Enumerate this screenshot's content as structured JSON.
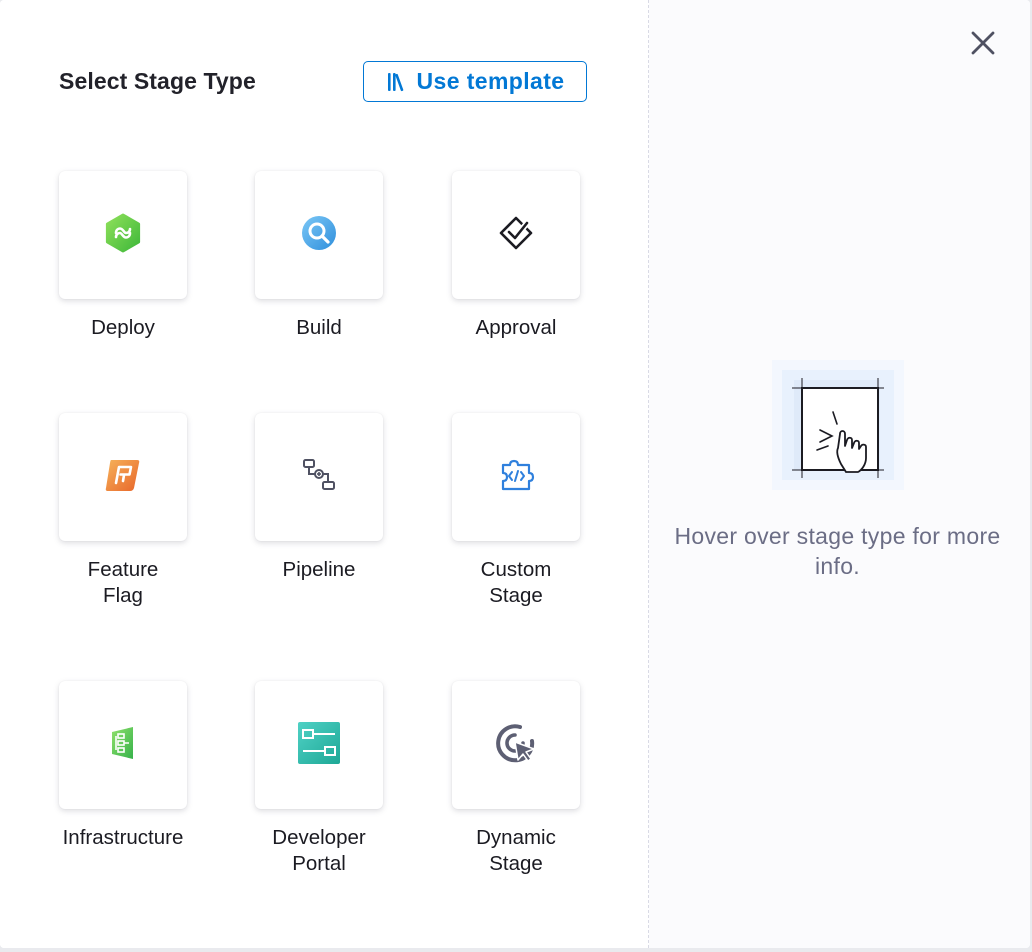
{
  "dialog": {
    "title": "Select Stage Type",
    "template_button_label": "Use template",
    "close_icon": "close-icon"
  },
  "stage_types": [
    {
      "label": "Deploy",
      "icon": "deploy-icon"
    },
    {
      "label": "Build",
      "icon": "build-icon"
    },
    {
      "label": "Approval",
      "icon": "approval-icon"
    },
    {
      "label": "Feature\nFlag",
      "icon": "feature-flag-icon"
    },
    {
      "label": "Pipeline",
      "icon": "pipeline-icon"
    },
    {
      "label": "Custom\nStage",
      "icon": "custom-stage-icon"
    },
    {
      "label": "Infrastructure",
      "icon": "infrastructure-icon"
    },
    {
      "label": "Developer\nPortal",
      "icon": "developer-portal-icon"
    },
    {
      "label": "Dynamic\nStage",
      "icon": "dynamic-stage-icon"
    }
  ],
  "info_panel": {
    "hint": "Hover over stage type for more info.",
    "illustration_icon": "hover-pointer-illustration"
  },
  "colors": {
    "accent": "#0278d5",
    "title_text": "#22222a",
    "hint_text": "#6b6d85"
  }
}
